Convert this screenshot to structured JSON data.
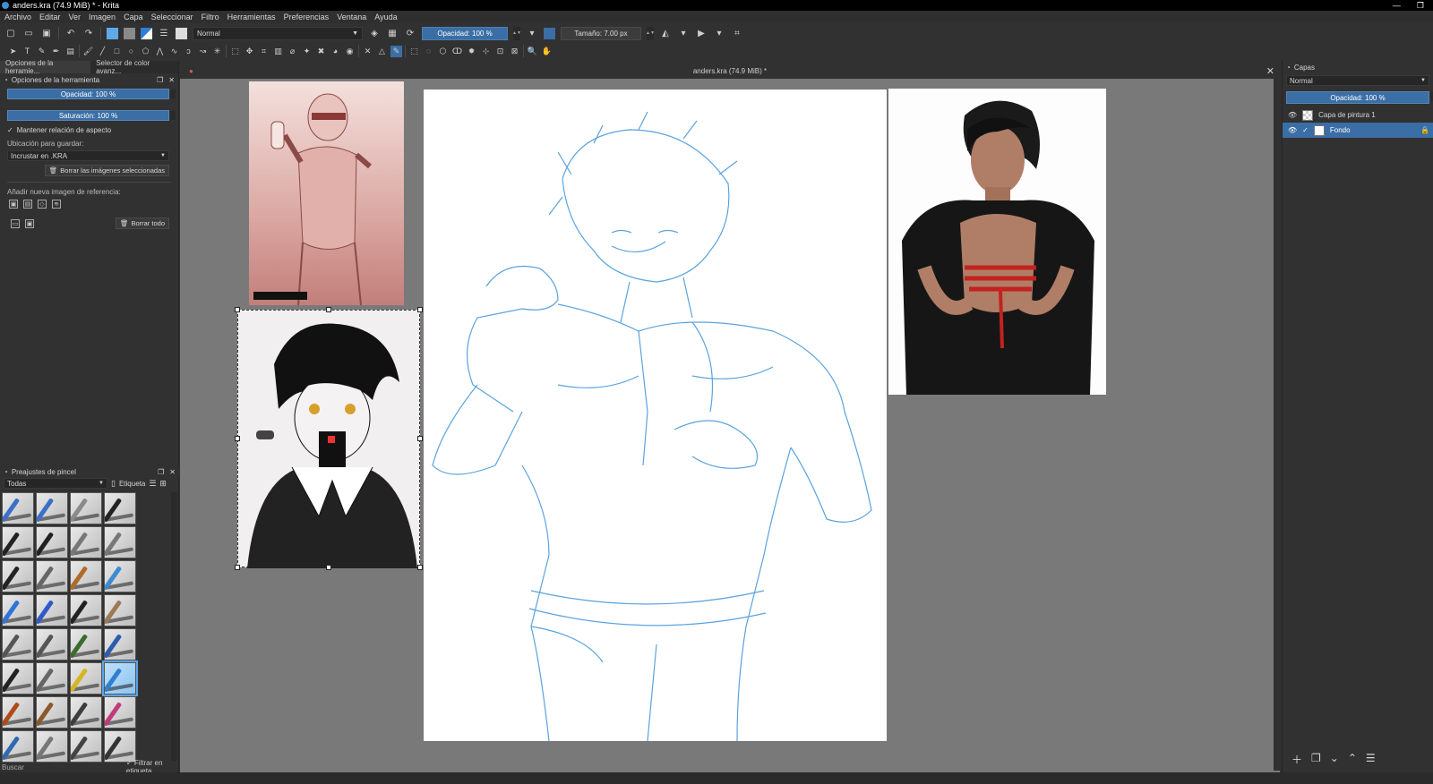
{
  "window": {
    "title": "anders.kra (74.9 MiB) * - Krita"
  },
  "menu": [
    "Archivo",
    "Editar",
    "Ver",
    "Imagen",
    "Capa",
    "Seleccionar",
    "Filtro",
    "Herramientas",
    "Preferencias",
    "Ventana",
    "Ayuda"
  ],
  "toolbar": {
    "blend_mode": "Normal",
    "opacity": "Opacidad: 100 %",
    "size": "Tamaño: 7.00 px"
  },
  "tool_options": {
    "tabs": [
      "Opciones de la herramie...",
      "Selector de color avanz..."
    ],
    "title": "Opciones de la herramienta",
    "opacity": "Opacidad: 100 %",
    "saturation": "Saturación: 100 %",
    "keep_aspect": "Mantener relación de aspecto",
    "save_location_label": "Ubicación para guardar:",
    "save_location_value": "Incrustar en .KRA",
    "delete_selected": "Borrar las imágenes seleccionadas",
    "add_reference": "Añadir nueva imagen de referencia:",
    "delete_all": "Borrar todo"
  },
  "brush_presets": {
    "title": "Preajustes de pincel",
    "filter": "Todas",
    "tag_label": "Etiqueta",
    "search_placeholder": "Buscar",
    "filter_by_tag": "Filtrar en etiqueta",
    "brush_colors": [
      "#3d6fc9",
      "#3d6fc9",
      "#8a8a8a",
      "#222",
      "#222",
      "#222",
      "#777",
      "#777",
      "#222",
      "#666",
      "#b06b2a",
      "#3d8ad1",
      "#2f73d8",
      "#2f5bc9",
      "#222",
      "#9b7a55",
      "#555",
      "#555",
      "#3c6b2e",
      "#2c5bb0",
      "#222",
      "#666",
      "#d6b520",
      "#2f80d0",
      "#b04a1c",
      "#8a5a2a",
      "#3d3d3d",
      "#c23a7a",
      "#2f6ab0",
      "#777",
      "#444",
      "#333"
    ]
  },
  "document": {
    "title": "anders.kra (74.9 MiB) *"
  },
  "layers": {
    "title": "Capas",
    "blend_mode": "Normal",
    "opacity": "Opacidad: 100 %",
    "items": [
      "Capa de pintura 1",
      "Fondo"
    ]
  },
  "colors": {
    "accent": "#3a6ea5",
    "sketch": "#5aa3dd"
  }
}
